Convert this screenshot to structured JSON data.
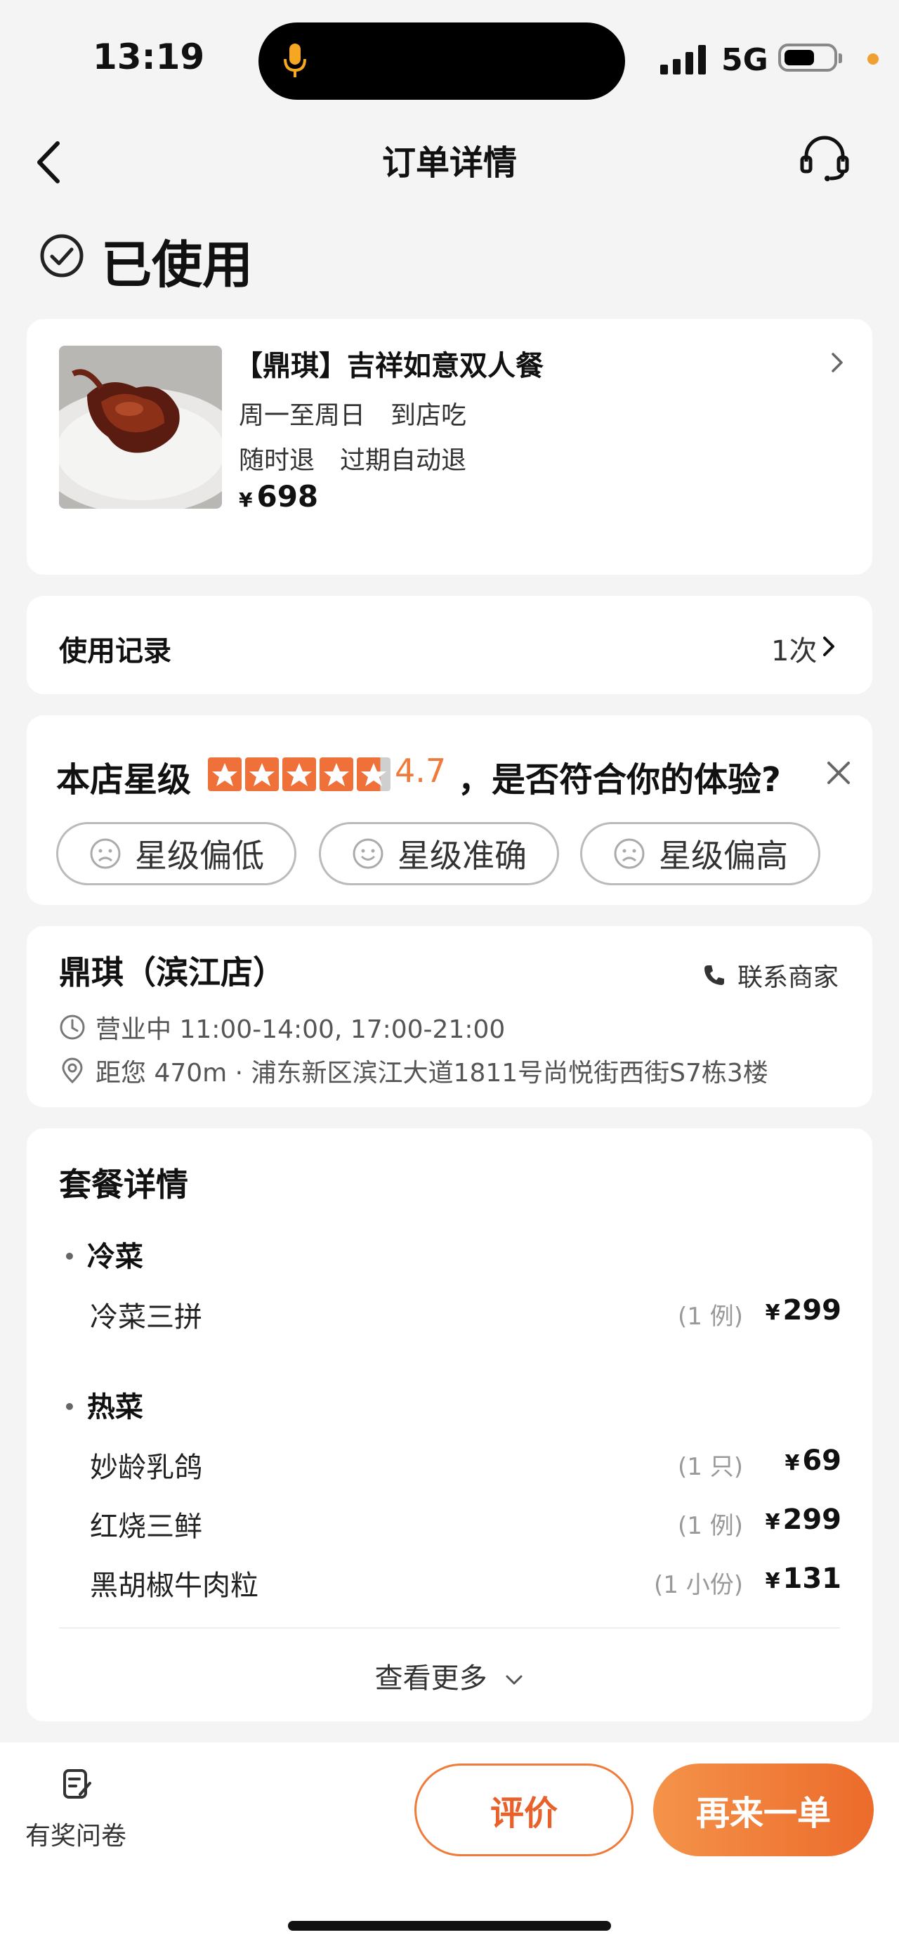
{
  "status_bar": {
    "time": "13:19",
    "network": "5G"
  },
  "nav": {
    "title": "订单详情"
  },
  "order_status": {
    "label": "已使用"
  },
  "product": {
    "title": "【鼎琪】吉祥如意双人餐",
    "schedule": "周一至周日　到店吃",
    "refund": "随时退　过期自动退",
    "currency": "¥",
    "price": "698"
  },
  "usage_record": {
    "label": "使用记录",
    "count": "1次"
  },
  "rating": {
    "label": "本店星级",
    "score": "4.7",
    "stars": 4.7,
    "question": "，是否符合你的体验?",
    "options": [
      "星级偏低",
      "星级准确",
      "星级偏高"
    ]
  },
  "shop": {
    "name": "鼎琪（滨江店）",
    "contact": "联系商家",
    "hours": "营业中 11:00-14:00, 17:00-21:00",
    "address": "距您 470m · 浦东新区滨江大道1811号尚悦街西街S7栋3楼"
  },
  "package": {
    "title": "套餐详情",
    "sections": [
      {
        "name": "冷菜",
        "items": [
          {
            "name": "冷菜三拼",
            "qty": "(1 例)",
            "price": "299"
          }
        ]
      },
      {
        "name": "热菜",
        "items": [
          {
            "name": "妙龄乳鸽",
            "qty": "(1 只)",
            "price": "69"
          },
          {
            "name": "红烧三鲜",
            "qty": "(1 例)",
            "price": "299"
          },
          {
            "name": "黑胡椒牛肉粒",
            "qty": "(1 小份)",
            "price": "131"
          }
        ]
      }
    ],
    "currency": "¥",
    "more_label": "查看更多"
  },
  "bottom_bar": {
    "survey_label": "有奖问卷",
    "review_button": "评价",
    "reorder_button": "再来一单"
  },
  "colors": {
    "accent": "#f07a3a",
    "star_orange": "#f0703a",
    "button_gradient_start": "#f4934a",
    "button_gradient_end": "#ec6b2b"
  },
  "icons": [
    "mic-icon",
    "signal-icon",
    "battery-icon",
    "back-arrow-icon",
    "customer-service-icon",
    "check-circle-icon",
    "chevron-right-icon",
    "close-icon",
    "sad-face-icon",
    "smile-face-icon",
    "phone-icon",
    "clock-icon",
    "location-icon",
    "chevron-down-icon",
    "survey-edit-icon"
  ]
}
